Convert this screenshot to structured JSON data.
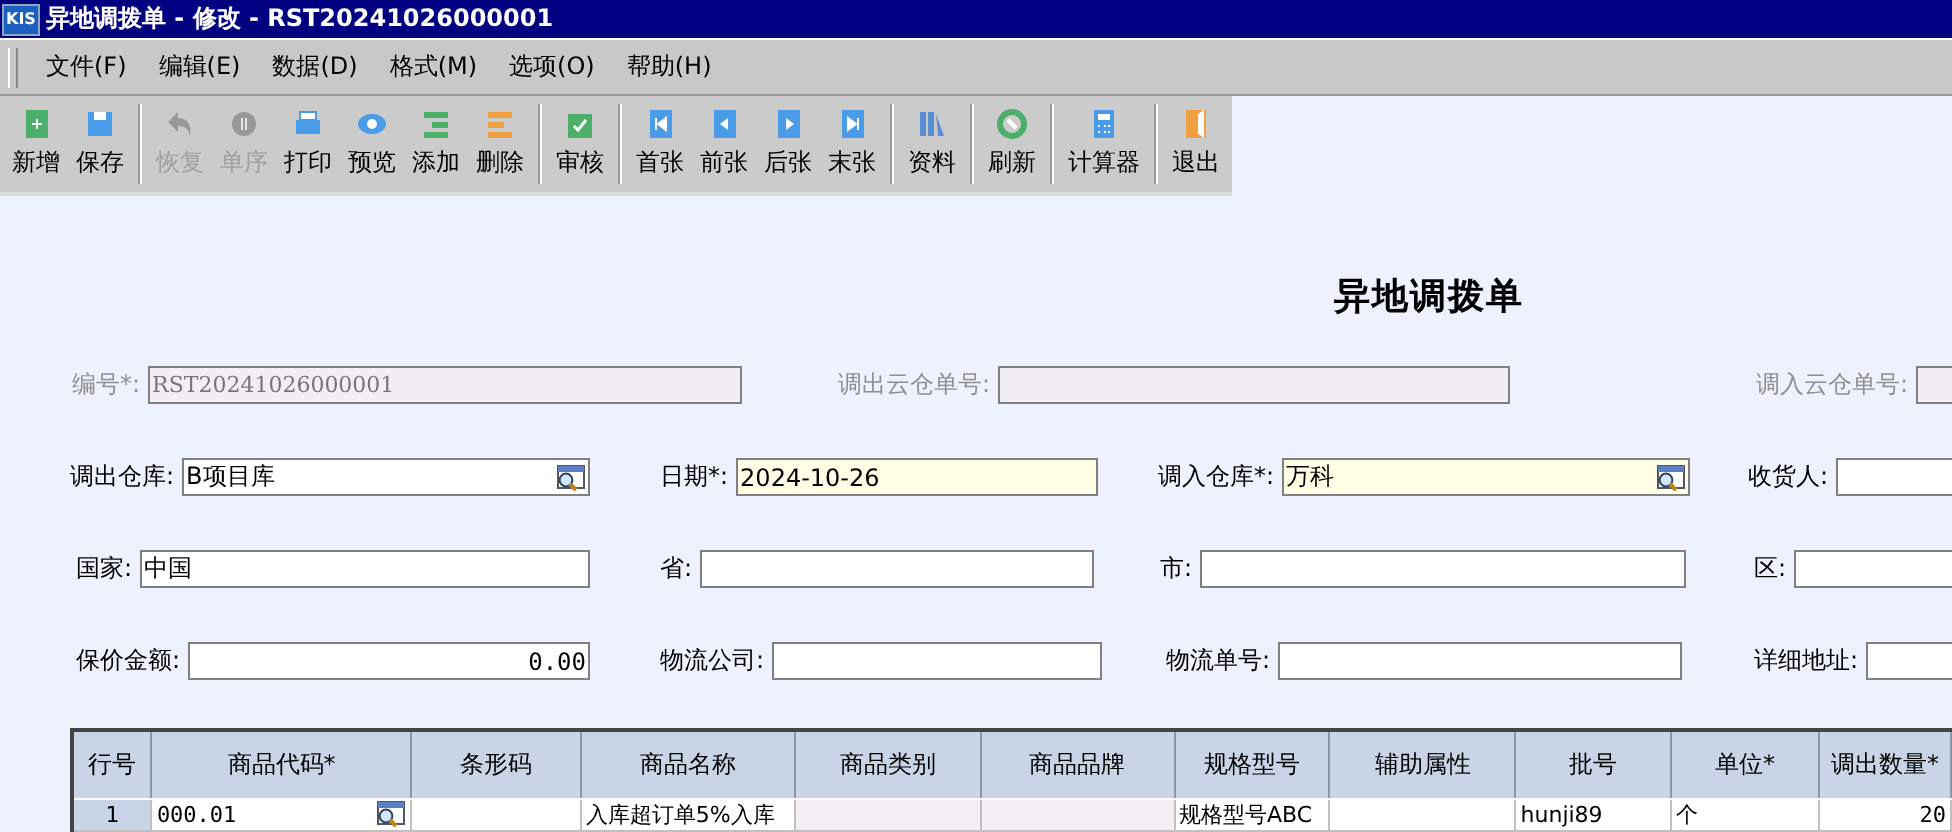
{
  "window": {
    "app_icon": "KIS",
    "title": "异地调拨单 - 修改 - RST20241026000001"
  },
  "menu": [
    "文件(F)",
    "编辑(E)",
    "数据(D)",
    "格式(M)",
    "选项(O)",
    "帮助(H)"
  ],
  "toolbar": [
    {
      "label": "新增",
      "disabled": false,
      "group_start": false
    },
    {
      "label": "保存",
      "disabled": false,
      "group_start": false
    },
    {
      "label": "恢复",
      "disabled": true,
      "group_start": true
    },
    {
      "label": "单序",
      "disabled": true,
      "group_start": false
    },
    {
      "label": "打印",
      "disabled": false,
      "group_start": false
    },
    {
      "label": "预览",
      "disabled": false,
      "group_start": false
    },
    {
      "label": "添加",
      "disabled": false,
      "group_start": false
    },
    {
      "label": "删除",
      "disabled": false,
      "group_start": false
    },
    {
      "label": "审核",
      "disabled": false,
      "group_start": true
    },
    {
      "label": "首张",
      "disabled": false,
      "group_start": true
    },
    {
      "label": "前张",
      "disabled": false,
      "group_start": false
    },
    {
      "label": "后张",
      "disabled": false,
      "group_start": false
    },
    {
      "label": "末张",
      "disabled": false,
      "group_start": false
    },
    {
      "label": "资料",
      "disabled": false,
      "group_start": true
    },
    {
      "label": "刷新",
      "disabled": false,
      "group_start": true
    },
    {
      "label": "计算器",
      "disabled": false,
      "group_start": true
    },
    {
      "label": "退出",
      "disabled": false,
      "group_start": true
    }
  ],
  "form": {
    "heading": "异地调拨单",
    "rows": [
      [
        {
          "label": "编号*:",
          "value": "RST20241026000001",
          "kind": "text",
          "disabled": true,
          "highlighted": false
        },
        {
          "label": "调出云仓单号:",
          "kind": "text",
          "disabled": true,
          "highlighted": false
        },
        null,
        {
          "label": "调入云仓单号:",
          "kind": "text",
          "disabled": true,
          "highlighted": false
        }
      ],
      [
        {
          "label": "调出仓库:",
          "value": "B项目库",
          "kind": "lookup",
          "disabled": false,
          "highlighted": false
        },
        {
          "label": "日期*:",
          "value": "2024-10-26",
          "kind": "text",
          "disabled": false,
          "highlighted": true
        },
        {
          "label": "调入仓库*:",
          "value": "万科",
          "kind": "lookup",
          "disabled": false,
          "highlighted": true
        },
        {
          "label": "收货人:",
          "kind": "text",
          "disabled": false,
          "highlighted": false
        }
      ],
      [
        {
          "label": "国家:",
          "value": "中国",
          "kind": "text",
          "disabled": false,
          "highlighted": false
        },
        {
          "label": "省:",
          "kind": "text",
          "disabled": false,
          "highlighted": false
        },
        {
          "label": "市:",
          "kind": "text",
          "disabled": false,
          "highlighted": false
        },
        {
          "label": "区:",
          "kind": "text",
          "disabled": false,
          "highlighted": false
        }
      ],
      [
        {
          "label": "保价金额:",
          "value": "0.00",
          "kind": "number",
          "disabled": false,
          "highlighted": false
        },
        {
          "label": "物流公司:",
          "kind": "text",
          "disabled": false,
          "highlighted": false
        },
        {
          "label": "物流单号:",
          "kind": "text",
          "disabled": false,
          "highlighted": false
        },
        {
          "label": "详细地址:",
          "kind": "text",
          "disabled": false,
          "highlighted": false
        }
      ]
    ]
  },
  "table": {
    "columns": [
      "行号",
      "商品代码*",
      "条形码",
      "商品名称",
      "商品类别",
      "商品品牌",
      "规格型号",
      "辅助属性",
      "批号",
      "单位*",
      "调出数量*"
    ],
    "rows": [
      [
        {
          "value": "1",
          "kind": "rownum",
          "readonly": false
        },
        {
          "value": "000.01",
          "kind": "lookup",
          "readonly": false
        },
        {
          "kind": "text",
          "readonly": false
        },
        {
          "value": "入库超订单5%入库",
          "kind": "text",
          "readonly": false
        },
        {
          "kind": "text",
          "readonly": true
        },
        {
          "kind": "text",
          "readonly": true
        },
        {
          "value": "规格型号ABC",
          "kind": "text",
          "readonly": false
        },
        {
          "kind": "text",
          "readonly": false
        },
        {
          "value": "hunji89",
          "kind": "text",
          "readonly": false
        },
        {
          "value": "个",
          "kind": "text",
          "readonly": false
        },
        {
          "value": "20",
          "kind": "number",
          "readonly": false
        }
      ]
    ]
  }
}
